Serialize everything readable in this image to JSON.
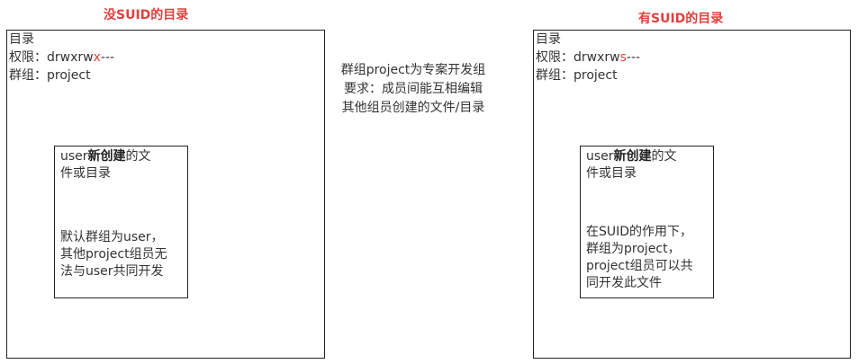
{
  "left": {
    "title": "没SUID的目录",
    "dir_label": "目录",
    "perm_label": "权限：",
    "perm_prefix": "drwxrw",
    "perm_special": "x",
    "perm_suffix": "---",
    "group_line": "群组：project",
    "inner": {
      "line1_pre": "user",
      "line1_bold": "新创建",
      "line1_post": "的文",
      "line2": "件或目录",
      "note": [
        "默认群组为user，",
        "其他project组员无",
        "法与user共同开发"
      ]
    }
  },
  "middle": {
    "lines": [
      "群组project为专案开发组",
      "要求：成员间能互相编辑",
      "其他组员创建的文件/目录"
    ]
  },
  "right": {
    "title": "有SUID的目录",
    "dir_label": "目录",
    "perm_label": "权限：",
    "perm_prefix": "drwxrw",
    "perm_special": "s",
    "perm_suffix": "---",
    "group_line": "群组：project",
    "inner": {
      "line1_pre": "user",
      "line1_bold": "新创建",
      "line1_post": "的文",
      "line2": "件或目录",
      "note": [
        "在SUID的作用下，",
        "群组为project，",
        "project组员可以共",
        "同开发此文件"
      ]
    }
  },
  "colors": {
    "accent_red": "#e0403c",
    "border": "#222222",
    "text": "#333333"
  }
}
